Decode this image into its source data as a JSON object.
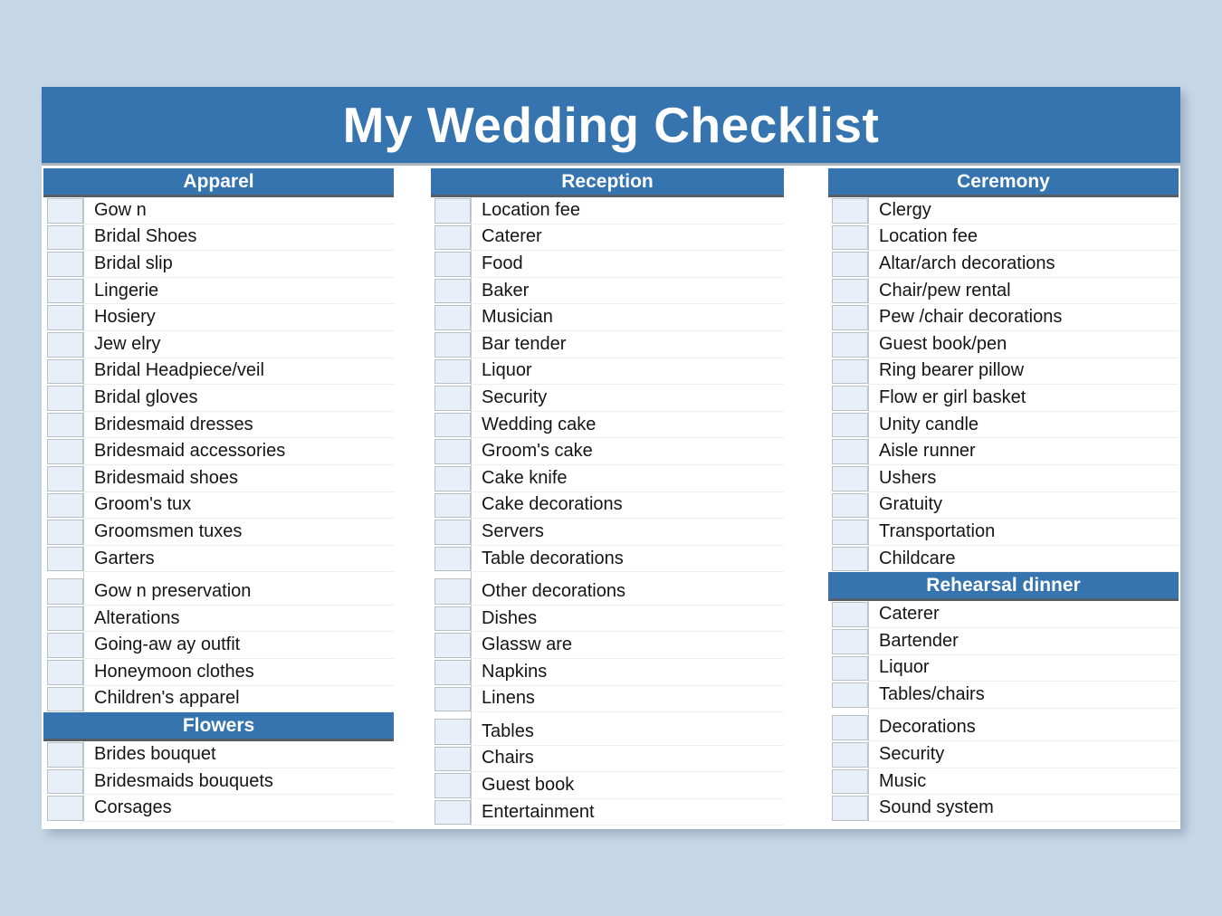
{
  "document": {
    "title": "My Wedding Checklist"
  },
  "colors": {
    "header_blue": "#3574ae",
    "page_background": "#c6d7e8",
    "checkbox_fill": "#e8eff8",
    "sheet_background": "#ffffff"
  },
  "columns": [
    {
      "id": "apparel",
      "sections": [
        {
          "heading": "Apparel",
          "items": [
            {
              "label": "Gow n",
              "checked": false,
              "gap_before": false
            },
            {
              "label": "Bridal Shoes",
              "checked": false,
              "gap_before": false
            },
            {
              "label": "Bridal slip",
              "checked": false,
              "gap_before": false
            },
            {
              "label": "Lingerie",
              "checked": false,
              "gap_before": false
            },
            {
              "label": "Hosiery",
              "checked": false,
              "gap_before": false
            },
            {
              "label": "Jew elry",
              "checked": false,
              "gap_before": false
            },
            {
              "label": "Bridal Headpiece/veil",
              "checked": false,
              "gap_before": false
            },
            {
              "label": "Bridal gloves",
              "checked": false,
              "gap_before": false
            },
            {
              "label": "Bridesmaid dresses",
              "checked": false,
              "gap_before": false
            },
            {
              "label": "Bridesmaid accessories",
              "checked": false,
              "gap_before": false
            },
            {
              "label": "Bridesmaid shoes",
              "checked": false,
              "gap_before": false
            },
            {
              "label": "Groom's tux",
              "checked": false,
              "gap_before": false
            },
            {
              "label": "Groomsmen tuxes",
              "checked": false,
              "gap_before": false
            },
            {
              "label": "Garters",
              "checked": false,
              "gap_before": false
            },
            {
              "label": "Gow n preservation",
              "checked": false,
              "gap_before": true
            },
            {
              "label": "Alterations",
              "checked": false,
              "gap_before": false
            },
            {
              "label": "Going-aw ay outfit",
              "checked": false,
              "gap_before": false
            },
            {
              "label": "Honeymoon clothes",
              "checked": false,
              "gap_before": false
            },
            {
              "label": "Children's apparel",
              "checked": false,
              "gap_before": false
            }
          ]
        },
        {
          "heading": "Flowers",
          "items": [
            {
              "label": "Brides bouquet",
              "checked": false,
              "gap_before": false
            },
            {
              "label": "Bridesmaids bouquets",
              "checked": false,
              "gap_before": false
            },
            {
              "label": "Corsages",
              "checked": false,
              "gap_before": false
            }
          ]
        }
      ]
    },
    {
      "id": "reception",
      "sections": [
        {
          "heading": "Reception",
          "items": [
            {
              "label": "Location fee",
              "checked": false,
              "gap_before": false
            },
            {
              "label": "Caterer",
              "checked": false,
              "gap_before": false
            },
            {
              "label": "Food",
              "checked": false,
              "gap_before": false
            },
            {
              "label": "Baker",
              "checked": false,
              "gap_before": false
            },
            {
              "label": "Musician",
              "checked": false,
              "gap_before": false
            },
            {
              "label": "Bar tender",
              "checked": false,
              "gap_before": false
            },
            {
              "label": "Liquor",
              "checked": false,
              "gap_before": false
            },
            {
              "label": "Security",
              "checked": false,
              "gap_before": false
            },
            {
              "label": "Wedding cake",
              "checked": false,
              "gap_before": false
            },
            {
              "label": "Groom's cake",
              "checked": false,
              "gap_before": false
            },
            {
              "label": "Cake knife",
              "checked": false,
              "gap_before": false
            },
            {
              "label": "Cake decorations",
              "checked": false,
              "gap_before": false
            },
            {
              "label": "Servers",
              "checked": false,
              "gap_before": false
            },
            {
              "label": "Table decorations",
              "checked": false,
              "gap_before": false
            },
            {
              "label": "Other decorations",
              "checked": false,
              "gap_before": true
            },
            {
              "label": "Dishes",
              "checked": false,
              "gap_before": false
            },
            {
              "label": "Glassw are",
              "checked": false,
              "gap_before": false
            },
            {
              "label": "Napkins",
              "checked": false,
              "gap_before": false
            },
            {
              "label": "Linens",
              "checked": false,
              "gap_before": false
            },
            {
              "label": "Tables",
              "checked": false,
              "gap_before": true
            },
            {
              "label": "Chairs",
              "checked": false,
              "gap_before": false
            },
            {
              "label": "Guest book",
              "checked": false,
              "gap_before": false
            },
            {
              "label": "Entertainment",
              "checked": false,
              "gap_before": false
            }
          ]
        }
      ]
    },
    {
      "id": "ceremony",
      "sections": [
        {
          "heading": "Ceremony",
          "items": [
            {
              "label": "Clergy",
              "checked": false,
              "gap_before": false
            },
            {
              "label": "Location fee",
              "checked": false,
              "gap_before": false
            },
            {
              "label": "Altar/arch decorations",
              "checked": false,
              "gap_before": false
            },
            {
              "label": "Chair/pew  rental",
              "checked": false,
              "gap_before": false
            },
            {
              "label": "Pew /chair decorations",
              "checked": false,
              "gap_before": false
            },
            {
              "label": "Guest book/pen",
              "checked": false,
              "gap_before": false
            },
            {
              "label": "Ring bearer pillow",
              "checked": false,
              "gap_before": false
            },
            {
              "label": "Flow er girl basket",
              "checked": false,
              "gap_before": false
            },
            {
              "label": "Unity candle",
              "checked": false,
              "gap_before": false
            },
            {
              "label": "Aisle runner",
              "checked": false,
              "gap_before": false
            },
            {
              "label": "Ushers",
              "checked": false,
              "gap_before": false
            },
            {
              "label": "Gratuity",
              "checked": false,
              "gap_before": false
            },
            {
              "label": "Transportation",
              "checked": false,
              "gap_before": false
            },
            {
              "label": "Childcare",
              "checked": false,
              "gap_before": false
            }
          ]
        },
        {
          "heading": "Rehearsal dinner",
          "items": [
            {
              "label": "Caterer",
              "checked": false,
              "gap_before": false
            },
            {
              "label": "Bartender",
              "checked": false,
              "gap_before": false
            },
            {
              "label": "Liquor",
              "checked": false,
              "gap_before": false
            },
            {
              "label": "Tables/chairs",
              "checked": false,
              "gap_before": false
            },
            {
              "label": "Decorations",
              "checked": false,
              "gap_before": true
            },
            {
              "label": "Security",
              "checked": false,
              "gap_before": false
            },
            {
              "label": "Music",
              "checked": false,
              "gap_before": false
            },
            {
              "label": "Sound system",
              "checked": false,
              "gap_before": false
            }
          ]
        }
      ]
    }
  ]
}
